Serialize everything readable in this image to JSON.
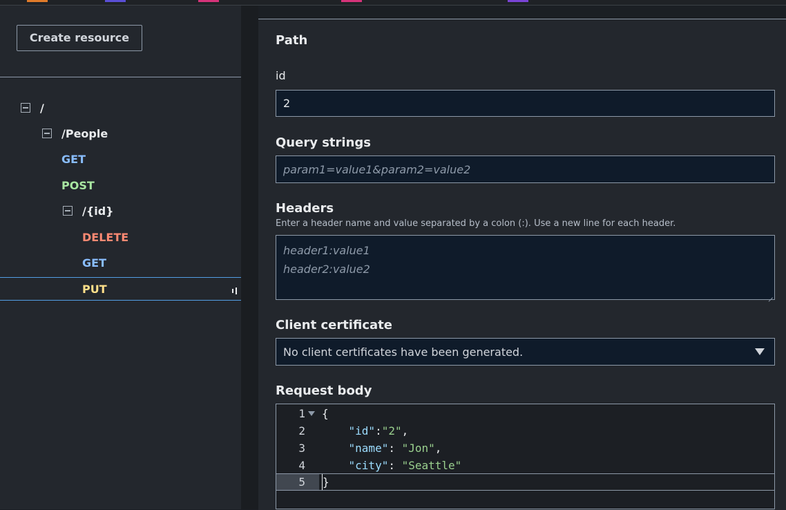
{
  "left_panel": {
    "create_button": "Create resource",
    "tree": {
      "root": "/",
      "people": "/People",
      "people_get": "GET",
      "people_post": "POST",
      "id_resource": "/{id}",
      "id_delete": "DELETE",
      "id_get": "GET",
      "id_put": "PUT"
    }
  },
  "form": {
    "path": {
      "title": "Path",
      "id_label": "id",
      "id_value": "2"
    },
    "query": {
      "title": "Query strings",
      "placeholder": "param1=value1&param2=value2"
    },
    "headers": {
      "title": "Headers",
      "hint": "Enter a header name and value separated by a colon (:). Use a new line for each header.",
      "placeholder_line1": "header1:value1",
      "placeholder_line2": "header2:value2"
    },
    "client_cert": {
      "title": "Client certificate",
      "selected": "No client certificates have been generated."
    },
    "request_body": {
      "title": "Request body",
      "lines": [
        {
          "n": "1",
          "text": "{"
        },
        {
          "n": "2",
          "key": "\"id\"",
          "sep": ":",
          "val": "\"2\"",
          "end": ","
        },
        {
          "n": "3",
          "key": "\"name\"",
          "sep": ": ",
          "val": "\"Jon\"",
          "end": ","
        },
        {
          "n": "4",
          "key": "\"city\"",
          "sep": ": ",
          "val": "\"Seattle\"",
          "end": ""
        },
        {
          "n": "5",
          "text": "}"
        }
      ]
    }
  },
  "colors": {
    "method_get": "#89bdff",
    "method_post": "#a8e6a1",
    "method_delete": "#ff8a73",
    "method_put": "#ffe08a",
    "selection_border": "#539fe5"
  }
}
